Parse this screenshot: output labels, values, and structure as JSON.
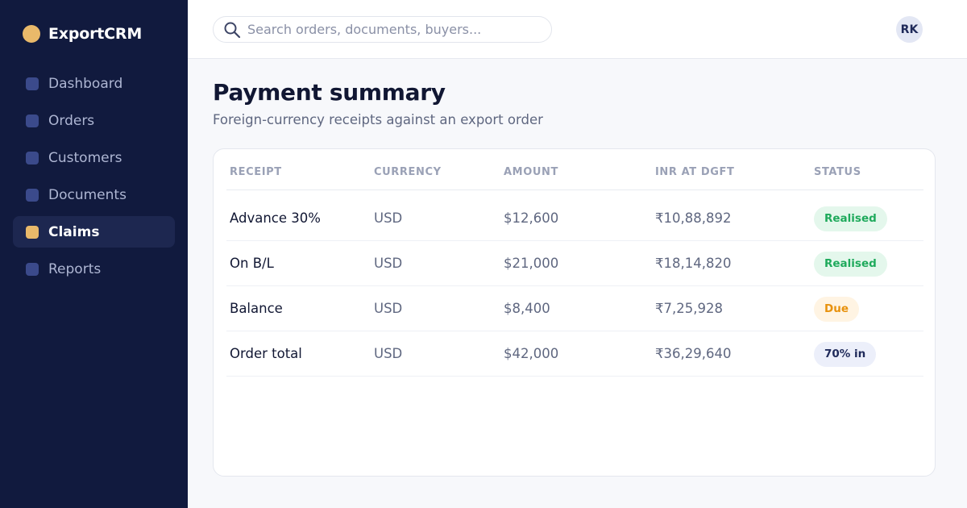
{
  "app": {
    "name": "ExportCRM"
  },
  "sidebar": {
    "items": [
      {
        "label": "Dashboard",
        "active": false
      },
      {
        "label": "Orders",
        "active": false
      },
      {
        "label": "Customers",
        "active": false
      },
      {
        "label": "Documents",
        "active": false
      },
      {
        "label": "Claims",
        "active": true
      },
      {
        "label": "Reports",
        "active": false
      }
    ]
  },
  "topbar": {
    "search_placeholder": "Search orders, documents, buyers...",
    "search_value": "",
    "avatar_initials": "RK"
  },
  "page": {
    "title": "Payment summary",
    "subtitle": "Foreign-currency receipts against an export order"
  },
  "table": {
    "headers": [
      "RECEIPT",
      "CURRENCY",
      "AMOUNT",
      "INR AT DGFT",
      "STATUS"
    ],
    "rows": [
      {
        "receipt": "Advance 30%",
        "currency": "USD",
        "amount": "$12,600",
        "inr": "₹10,88,892",
        "status": "Realised",
        "status_type": "green"
      },
      {
        "receipt": "On B/L",
        "currency": "USD",
        "amount": "$21,000",
        "inr": "₹18,14,820",
        "status": "Realised",
        "status_type": "green"
      },
      {
        "receipt": "Balance",
        "currency": "USD",
        "amount": "$8,400",
        "inr": "₹7,25,928",
        "status": "Due",
        "status_type": "amber"
      },
      {
        "receipt": "Order total",
        "currency": "USD",
        "amount": "$42,000",
        "inr": "₹36,29,640",
        "status": "70% in",
        "status_type": "navy"
      }
    ]
  },
  "colors": {
    "sidebar_bg": "#111a3e",
    "accent": "#e9b96a",
    "realised": "#1faa5c",
    "due": "#e8920e"
  },
  "icons": {
    "brand": "brand-logo-icon",
    "search": "search-icon",
    "nav": "nav-square-icon"
  }
}
